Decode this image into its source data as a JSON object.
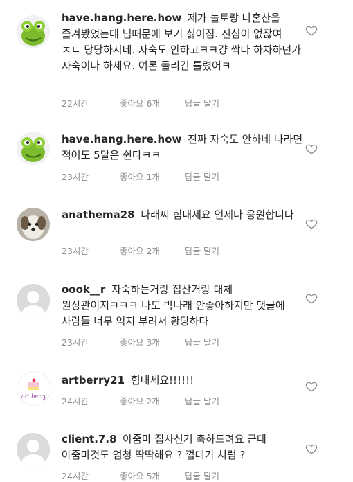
{
  "comments": [
    {
      "username": "have.hang.here.how",
      "text": "제가 놀토랑 나혼산을 즐겨봤었는데 님때문에 보기 싫어짐. 진심이 없잖여 ㅈㄴ 당당하시네. 자숙도 안하고ㅋㅋ걍 싹다 하차하던가 자숙이나 하세요. 여론 돌리긴 틀렸어ㅋ",
      "time": "22시간",
      "likes": "좋아요 6개",
      "reply": "답글 달기",
      "avatar": "frog-avatar"
    },
    {
      "username": "have.hang.here.how",
      "text": "진짜 자숙도 안하네 나라면 적어도 5달은 쉰다ㅋㅋ",
      "time": "23시간",
      "likes": "좋아요 1개",
      "reply": "답글 달기",
      "avatar": "frog-avatar"
    },
    {
      "username": "anathema28",
      "text": "나래씨 힘내세요 언제나 응원합니다",
      "time": "23시간",
      "likes": "좋아요 2개",
      "reply": "답글 달기",
      "avatar": "dog-avatar"
    },
    {
      "username": "oook__r",
      "text": "자숙하는거랑 집산거랑 대체 뭔상관이지ㅋㅋㅋ 나도 박나래 안좋아하지만 댓글에 사람들 너무 억지 부려서 황당하다",
      "time": "23시간",
      "likes": "좋아요 3개",
      "reply": "답글 달기",
      "avatar": "default-avatar"
    },
    {
      "username": "artberry21",
      "text": "힘내세요!!!!!!",
      "time": "24시간",
      "likes": "좋아요 2개",
      "reply": "답글 달기",
      "avatar": "artberry-avatar",
      "avatar_text": "art berry"
    },
    {
      "username": "client.7.8",
      "text": "아줌마 집사신거 축하드려요 근데 아줌마것도 엄청 딱딱해요 ? 껍데기 처럼 ?",
      "time": "24시간",
      "likes": "좋아요 5개",
      "reply": "답글 달기",
      "avatar": "default-avatar"
    }
  ]
}
